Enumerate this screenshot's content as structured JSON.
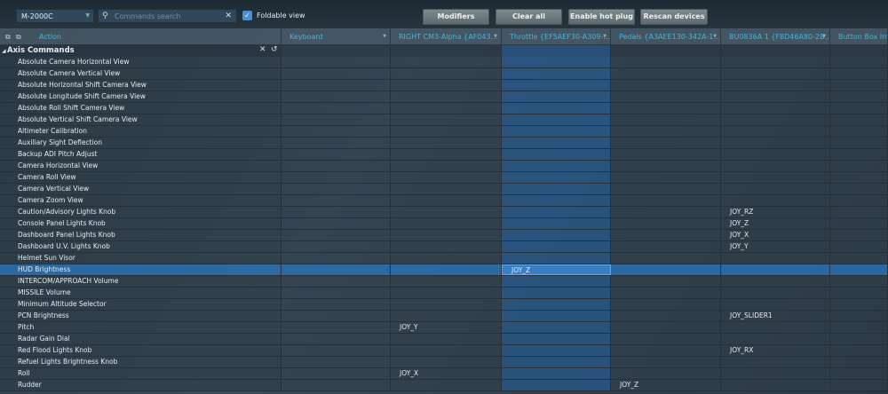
{
  "toolbar": {
    "aircraft": "M-2000C",
    "search_placeholder": "Commands search",
    "foldable_label": "Foldable view",
    "foldable_checked": true,
    "buttons": [
      "Modifiers",
      "Clear all",
      "Enable hot plug",
      "Rescan devices"
    ]
  },
  "columns": [
    "Action",
    "Keyboard",
    "RIGHT CM3-Alpha {AF043...",
    "Throttle {EF5AEF30-A309-...",
    "Pedals {A3AEE130-342A-1...",
    "BU0836A 1 {F8D46A80-2B...",
    "Button Box Int"
  ],
  "category": "Axis Commands",
  "rows": [
    [
      "Absolute Camera Horizontal View",
      "",
      "",
      "",
      "",
      "",
      ""
    ],
    [
      "Absolute Camera Vertical View",
      "",
      "",
      "",
      "",
      "",
      ""
    ],
    [
      "Absolute Horizontal Shift Camera View",
      "",
      "",
      "",
      "",
      "",
      ""
    ],
    [
      "Absolute Longitude Shift Camera View",
      "",
      "",
      "",
      "",
      "",
      ""
    ],
    [
      "Absolute Roll Shift Camera View",
      "",
      "",
      "",
      "",
      "",
      ""
    ],
    [
      "Absolute Vertical Shift Camera View",
      "",
      "",
      "",
      "",
      "",
      ""
    ],
    [
      "Altimeter Calibration",
      "",
      "",
      "",
      "",
      "",
      ""
    ],
    [
      "Auxiliary Sight Deflection",
      "",
      "",
      "",
      "",
      "",
      ""
    ],
    [
      "Backup ADI Pitch Adjust",
      "",
      "",
      "",
      "",
      "",
      ""
    ],
    [
      "Camera Horizontal View",
      "",
      "",
      "",
      "",
      "",
      ""
    ],
    [
      "Camera Roll View",
      "",
      "",
      "",
      "",
      "",
      ""
    ],
    [
      "Camera Vertical View",
      "",
      "",
      "",
      "",
      "",
      ""
    ],
    [
      "Camera Zoom View",
      "",
      "",
      "",
      "",
      "",
      ""
    ],
    [
      "Caution/Advisory Lights Knob",
      "",
      "",
      "",
      "",
      "JOY_RZ",
      ""
    ],
    [
      "Console Panel Lights Knob",
      "",
      "",
      "",
      "",
      "JOY_Z",
      ""
    ],
    [
      "Dashboard Panel Lights Knob",
      "",
      "",
      "",
      "",
      "JOY_X",
      ""
    ],
    [
      "Dashboard U.V. Lights Knob",
      "",
      "",
      "",
      "",
      "JOY_Y",
      ""
    ],
    [
      "Helmet Sun Visor",
      "",
      "",
      "",
      "",
      "",
      ""
    ],
    [
      "HUD Brightness",
      "",
      "",
      "JOY_Z",
      "",
      "",
      ""
    ],
    [
      "INTERCOM/APPROACH Volume",
      "",
      "",
      "",
      "",
      "",
      ""
    ],
    [
      "MISSILE Volume",
      "",
      "",
      "",
      "",
      "",
      ""
    ],
    [
      "Minimum Altitude Selector",
      "",
      "",
      "",
      "",
      "",
      ""
    ],
    [
      "PCN Brightness",
      "",
      "",
      "",
      "",
      "JOY_SLIDER1",
      ""
    ],
    [
      "Pitch",
      "",
      "JOY_Y",
      "",
      "",
      "",
      ""
    ],
    [
      "Radar Gain Dial",
      "",
      "",
      "",
      "",
      "",
      ""
    ],
    [
      "Red Flood Lights Knob",
      "",
      "",
      "",
      "",
      "JOY_RX",
      ""
    ],
    [
      "Refuel Lights Brightness Knob",
      "",
      "",
      "",
      "",
      "",
      ""
    ],
    [
      "Roll",
      "",
      "JOY_X",
      "",
      "",
      "",
      ""
    ],
    [
      "Rudder",
      "",
      "",
      "",
      "JOY_Z",
      "",
      ""
    ]
  ],
  "selected_row": 18
}
